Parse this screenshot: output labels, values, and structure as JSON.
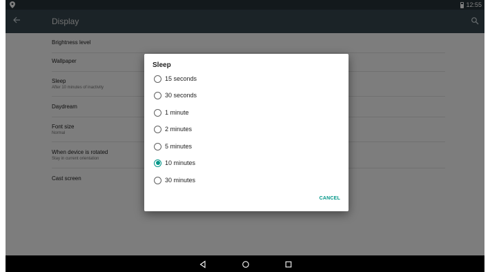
{
  "status_bar": {
    "time": "12:55"
  },
  "app_bar": {
    "title": "Display"
  },
  "settings": [
    {
      "label": "Brightness level",
      "sub": ""
    },
    {
      "label": "Wallpaper",
      "sub": ""
    },
    {
      "label": "Sleep",
      "sub": "After 10 minutes of inactivity"
    },
    {
      "label": "Daydream",
      "sub": ""
    },
    {
      "label": "Font size",
      "sub": "Normal"
    },
    {
      "label": "When device is rotated",
      "sub": "Stay in current orientation"
    },
    {
      "label": "Cast screen",
      "sub": ""
    }
  ],
  "dialog": {
    "title": "Sleep",
    "options": [
      "15 seconds",
      "30 seconds",
      "1 minute",
      "2 minutes",
      "5 minutes",
      "10 minutes",
      "30 minutes"
    ],
    "selected_index": 5,
    "cancel_label": "CANCEL"
  },
  "icons": {
    "status_left": "location-pin-icon",
    "battery": "battery-icon",
    "back": "arrow-back-icon",
    "search": "search-icon",
    "nav_back": "nav-back-icon",
    "nav_home": "nav-home-icon",
    "nav_recent": "nav-recent-icon"
  },
  "colors": {
    "accent": "#009688",
    "app_bar": "#37474f",
    "status_bar": "#263238"
  }
}
